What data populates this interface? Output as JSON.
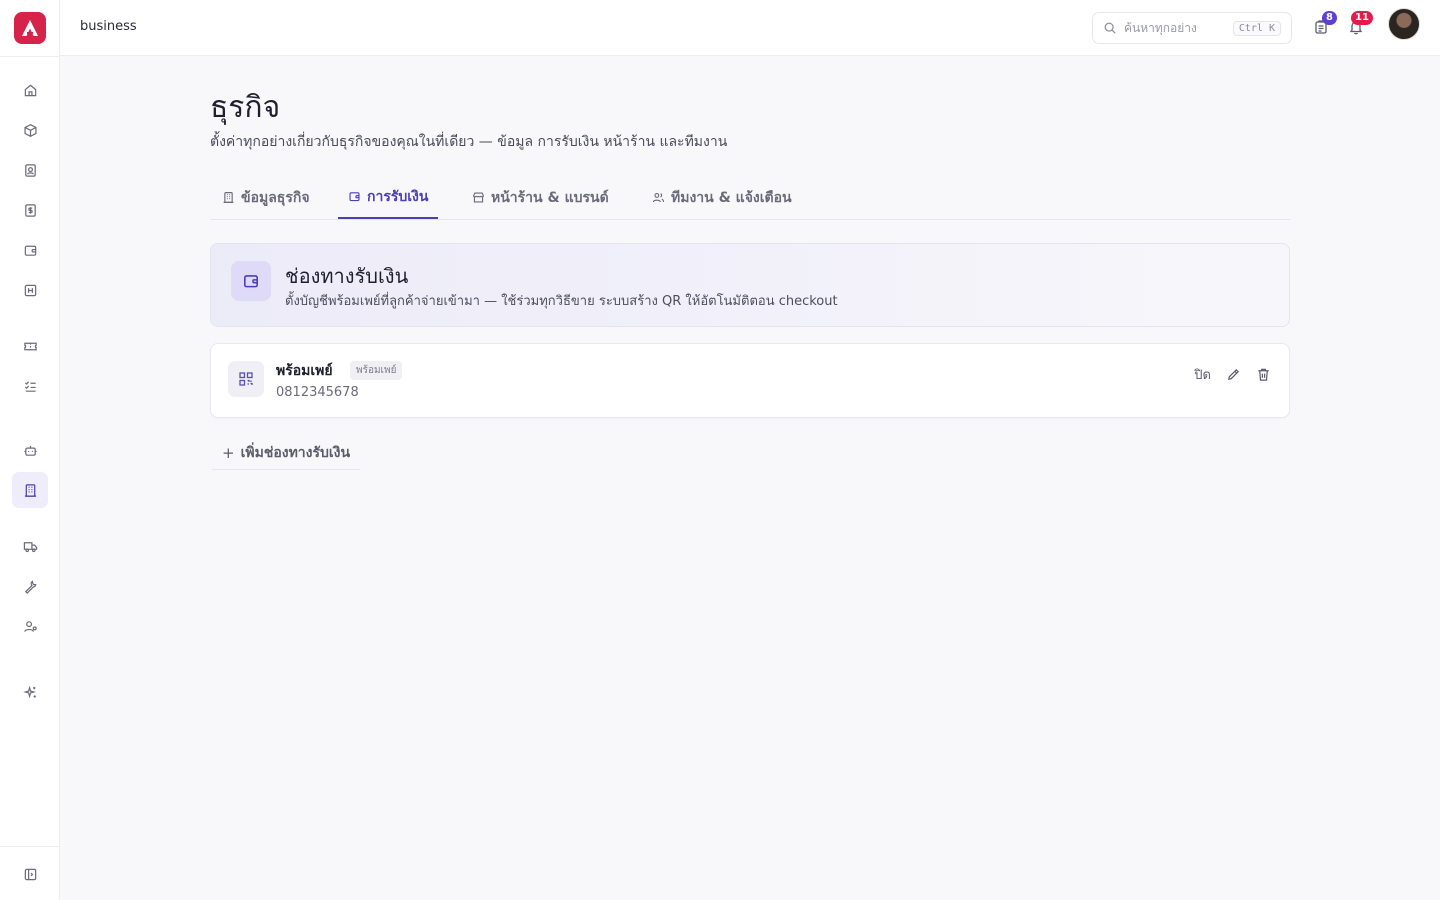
{
  "header": {
    "breadcrumb": "business",
    "search_placeholder": "ค้นหาทุกอย่าง",
    "search_shortcut": "Ctrl K",
    "tasks_badge": "8",
    "notifications_badge": "11"
  },
  "sidebar": {
    "items": [
      {
        "name": "home-icon"
      },
      {
        "name": "box-icon"
      },
      {
        "name": "contact-icon"
      },
      {
        "name": "receipt-icon"
      },
      {
        "name": "wallet-icon"
      },
      {
        "name": "calendar-icon"
      },
      {
        "name": "ticket-icon"
      },
      {
        "name": "checklist-icon"
      },
      {
        "name": "bot-icon"
      },
      {
        "name": "building-icon"
      },
      {
        "name": "truck-icon"
      },
      {
        "name": "wrench-icon"
      },
      {
        "name": "user-settings-icon"
      },
      {
        "name": "sparkles-icon"
      },
      {
        "name": "collapse-sidebar-icon"
      }
    ]
  },
  "page": {
    "title": "ธุรกิจ",
    "subtitle": "ตั้งค่าทุกอย่างเกี่ยวกับธุรกิจของคุณในที่เดียว — ข้อมูล การรับเงิน หน้าร้าน และทีมงาน"
  },
  "tabs": [
    {
      "label": "ข้อมูลธุรกิจ"
    },
    {
      "label": "การรับเงิน"
    },
    {
      "label": "หน้าร้าน & แบรนด์"
    },
    {
      "label": "ทีมงาน & แจ้งเตือน"
    }
  ],
  "channels": {
    "title": "ช่องทางรับเงิน",
    "description": "ตั้งบัญชีพร้อมเพย์ที่ลูกค้าจ่ายเข้ามา — ใช้ร่วมทุกวิธีขาย ระบบสร้าง QR ให้อัตโนมัติตอน checkout"
  },
  "account": {
    "name": "พร้อมเพย์",
    "type_badge": "พร้อมเพย์",
    "number": "0812345678",
    "toggle_label": "ปิด"
  },
  "add_channel_label": "เพิ่มช่องทางรับเงิน",
  "colors": {
    "accent": "#4b3fb5",
    "logo": "#d6234a",
    "badge_purple": "#5b3fd6",
    "badge_red": "#e11d48"
  }
}
